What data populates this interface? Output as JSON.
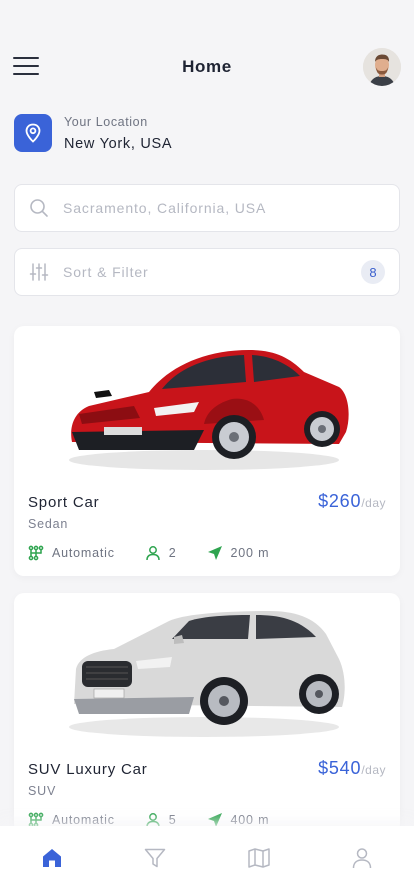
{
  "header": {
    "title": "Home"
  },
  "location": {
    "label": "Your Location",
    "value": "New York, USA"
  },
  "search": {
    "placeholder": "Sacramento, California, USA"
  },
  "filter": {
    "label": "Sort & Filter",
    "count": "8"
  },
  "colors": {
    "accent": "#3a63d8",
    "spec_green": "#2ea44f",
    "card_bg": "#ffffff",
    "page_bg": "#f5f5f7"
  },
  "cars": [
    {
      "name": "Sport Car",
      "type": "Sedan",
      "price": "$260",
      "unit": "/day",
      "transmission": "Automatic",
      "seats": "2",
      "distance": "200 m",
      "body_color": "#c8141a"
    },
    {
      "name": "SUV Luxury Car",
      "type": "SUV",
      "price": "$540",
      "unit": "/day",
      "transmission": "Automatic",
      "seats": "5",
      "distance": "400 m",
      "body_color": "#d9d9d9"
    }
  ],
  "nav": {
    "items": [
      {
        "icon": "home-icon",
        "active": true
      },
      {
        "icon": "filter-icon",
        "active": false
      },
      {
        "icon": "map-icon",
        "active": false
      },
      {
        "icon": "profile-icon",
        "active": false
      }
    ]
  }
}
